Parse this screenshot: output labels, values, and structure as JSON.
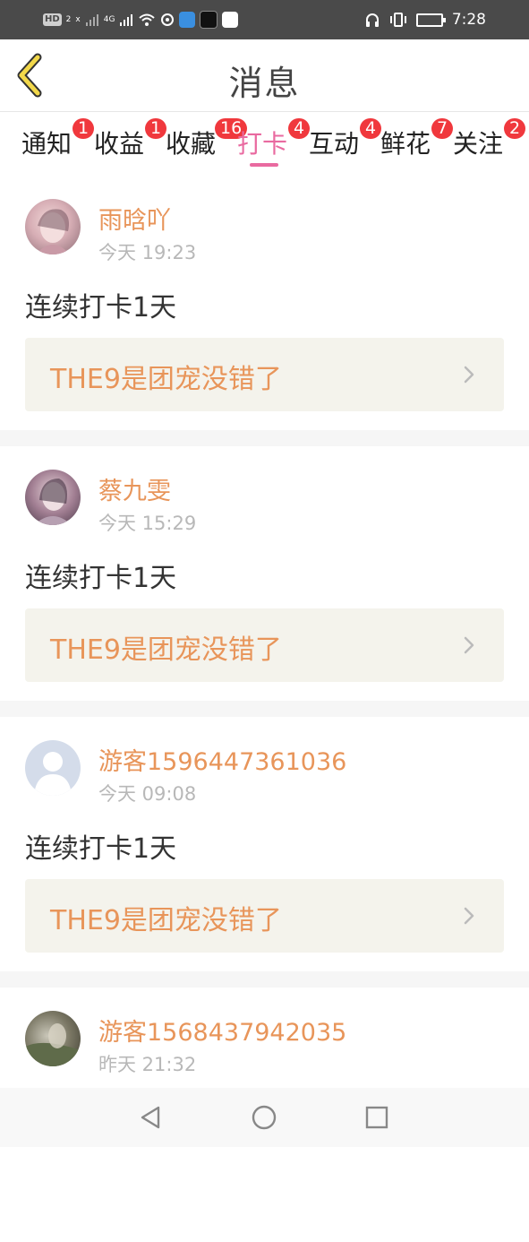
{
  "status_bar": {
    "hd_badge": "HD",
    "hd_sub": "2",
    "net_a": "x",
    "net_b": "4G",
    "time": "7:28"
  },
  "header": {
    "title": "消息"
  },
  "tabs": [
    {
      "label": "通知",
      "badge": "1",
      "active": false
    },
    {
      "label": "收益",
      "badge": "1",
      "active": false
    },
    {
      "label": "收藏",
      "badge": "16",
      "active": false
    },
    {
      "label": "打卡",
      "badge": "4",
      "active": true
    },
    {
      "label": "互动",
      "badge": "4",
      "active": false
    },
    {
      "label": "鲜花",
      "badge": "7",
      "active": false
    },
    {
      "label": "关注",
      "badge": "2",
      "active": false
    }
  ],
  "feed": [
    {
      "username": "雨晗吖",
      "time": "今天 19:23",
      "message": "连续打卡1天",
      "link_text": "THE9是团宠没错了",
      "avatar": "photo-girl-pink"
    },
    {
      "username": "蔡九雯",
      "time": "今天 15:29",
      "message": "连续打卡1天",
      "link_text": "THE9是团宠没错了",
      "avatar": "photo-girl-purple"
    },
    {
      "username": "游客1596447361036",
      "time": "今天 09:08",
      "message": "连续打卡1天",
      "link_text": "THE9是团宠没错了",
      "avatar": "default-user-icon"
    },
    {
      "username": "游客1568437942035",
      "time": "昨天 21:32",
      "message": "",
      "link_text": "",
      "avatar": "photo-outdoor"
    }
  ],
  "colors": {
    "accent_pink": "#e96aa0",
    "username_orange": "#e8955a",
    "badge_red": "#f0383d",
    "back_arrow_yellow": "#f2d84a",
    "link_box_bg": "#f4f3ec"
  }
}
